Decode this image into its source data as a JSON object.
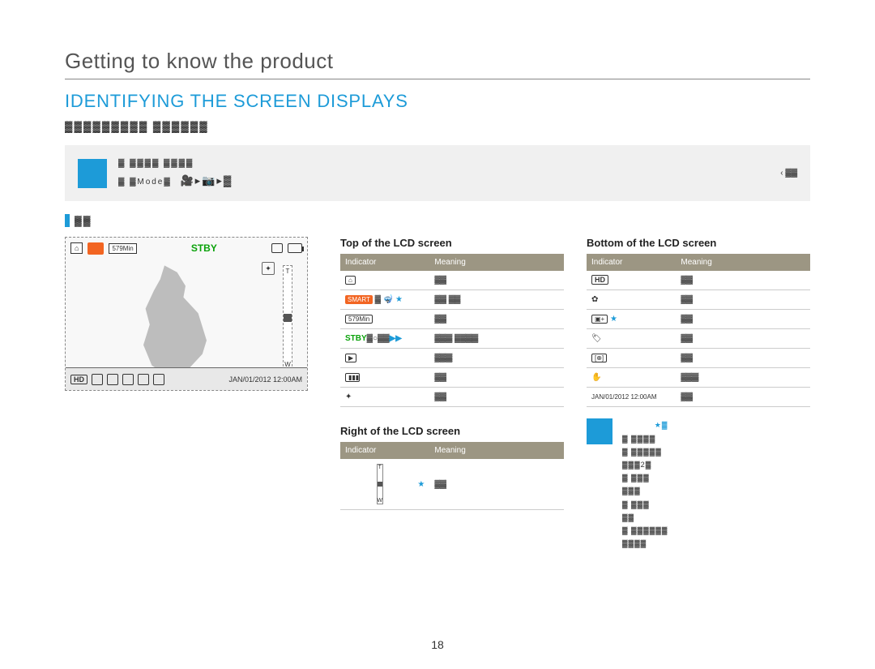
{
  "chapter": "Getting to know the product",
  "section": "IDENTIFYING THE SCREEN DISPLAYS",
  "subtitle_blurred": "▓▓▓▓▓▓▓▓▓ ▓▓▓▓▓▓",
  "note": {
    "line1": "▓ ▓▓▓▓ ▓▓▓▓",
    "line2_a": "▓ ▓Mode▓",
    "line2_icons": "🎥▸📷▸▓",
    "line2_b": "‹ ▓▓"
  },
  "mode_bar": "▓▓",
  "lcd": {
    "memory_time": "579Min",
    "status": "STBY",
    "zoom_t": "T",
    "zoom_w": "W",
    "hd": "HD",
    "datetime": "JAN/01/2012 12:00AM"
  },
  "tables": {
    "top": {
      "title": "Top of the LCD screen",
      "col_indicator": "Indicator",
      "col_meaning": "Meaning",
      "rows": [
        {
          "ind_type": "card",
          "meaning": "▓▓"
        },
        {
          "ind_type": "smart",
          "meaning": "▓▓ ▓▓"
        },
        {
          "ind_type": "579",
          "meaning": "▓▓"
        },
        {
          "ind_type": "stby",
          "meaning": "▓▓▓  ▓▓▓▓"
        },
        {
          "ind_type": "play",
          "meaning": "▓▓▓"
        },
        {
          "ind_type": "batt",
          "meaning": "▓▓"
        },
        {
          "ind_type": "star2",
          "meaning": "▓▓"
        }
      ]
    },
    "right": {
      "title": "Right of the LCD screen",
      "col_indicator": "Indicator",
      "col_meaning": "Meaning",
      "rows": [
        {
          "ind_type": "zoom",
          "meaning": "▓▓"
        }
      ]
    },
    "bottom": {
      "title": "Bottom of the LCD screen",
      "col_indicator": "Indicator",
      "col_meaning": "Meaning",
      "rows": [
        {
          "ind_type": "hd",
          "meaning": "▓▓"
        },
        {
          "ind_type": "gear",
          "meaning": "▓▓"
        },
        {
          "ind_type": "exp",
          "meaning": "▓▓"
        },
        {
          "ind_type": "wb",
          "meaning": "▓▓"
        },
        {
          "ind_type": "focus",
          "meaning": "▓▓"
        },
        {
          "ind_type": "hand",
          "meaning": "▓▓▓"
        },
        {
          "ind_type": "date",
          "meaning": "▓▓"
        }
      ]
    }
  },
  "footnotes": {
    "star_marker": "★▓",
    "lines": [
      "▓  ▓▓▓▓",
      "▓  ▓▓▓▓▓",
      "   ▓▓▓2▓",
      "▓  ▓▓▓",
      "   ▓▓▓",
      "▓  ▓▓▓",
      "   ▓▓",
      "▓  ▓▓▓▓▓▓",
      "   ▓▓▓▓"
    ]
  },
  "page_number": "18"
}
